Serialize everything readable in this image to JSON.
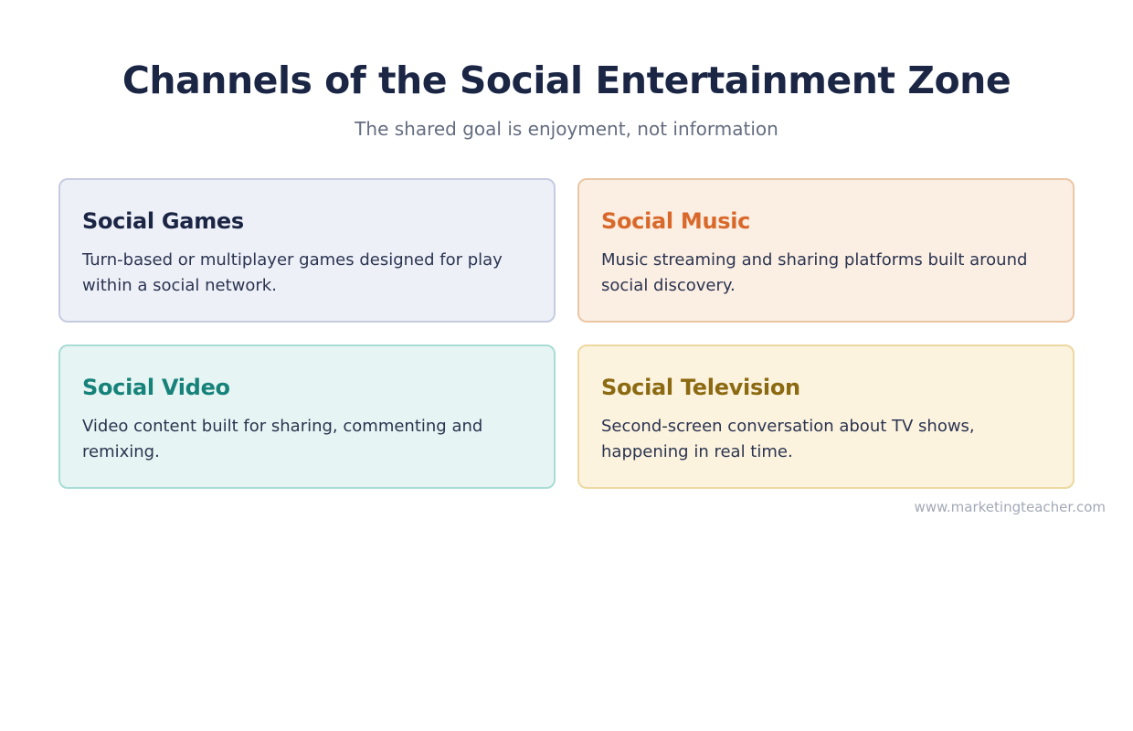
{
  "page": {
    "title": "Channels of the Social Entertainment Zone",
    "subtitle": "The shared goal is enjoyment, not information"
  },
  "cards": [
    {
      "title": "Social Games",
      "description": "Turn-based or multiplayer games designed for play within a social network.",
      "accent_color": "#1b2645"
    },
    {
      "title": "Social Music",
      "description": "Music streaming and sharing platforms built around social discovery.",
      "accent_color": "#d9692b"
    },
    {
      "title": "Social Video",
      "description": "Video content built for sharing, commenting and remixing.",
      "accent_color": "#17827a"
    },
    {
      "title": "Social Television",
      "description": "Second-screen conversation about TV shows, happening in real time.",
      "accent_color": "#8c6a12"
    }
  ],
  "footer": {
    "source": "www.marketingteacher.com"
  }
}
